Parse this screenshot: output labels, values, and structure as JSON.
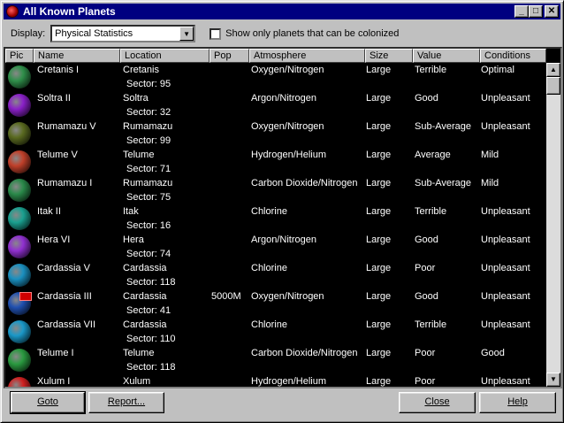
{
  "window": {
    "title": "All Known Planets"
  },
  "titlebar_buttons": {
    "minimize": "_",
    "maximize": "□",
    "close": "✕"
  },
  "toolbar": {
    "display_label": "Display:",
    "display_value": "Physical Statistics",
    "colonize_checkbox_label": "Show only planets that can be colonized",
    "colonize_checked": false
  },
  "columns": [
    "Pic",
    "Name",
    "Location",
    "Pop",
    "Atmosphere",
    "Size",
    "Value",
    "Conditions"
  ],
  "rows": [
    {
      "name": "Cretanis I",
      "location": "Cretanis",
      "sector": "Sector: 95",
      "pop": "",
      "atmosphere": "Oxygen/Nitrogen",
      "size": "Large",
      "value": "Terrible",
      "conditions": "Optimal",
      "color": "#2f8f4a",
      "flag": false
    },
    {
      "name": "Soltra II",
      "location": "Soltra",
      "sector": "Sector: 32",
      "pop": "",
      "atmosphere": "Argon/Nitrogen",
      "size": "Large",
      "value": "Good",
      "conditions": "Unpleasant",
      "color": "#8a20c8",
      "flag": false
    },
    {
      "name": "Rumamazu V",
      "location": "Rumamazu",
      "sector": "Sector: 99",
      "pop": "",
      "atmosphere": "Oxygen/Nitrogen",
      "size": "Large",
      "value": "Sub-Average",
      "conditions": "Unpleasant",
      "color": "#5a6a20",
      "flag": false
    },
    {
      "name": "Telume V",
      "location": "Telume",
      "sector": "Sector: 71",
      "pop": "",
      "atmosphere": "Hydrogen/Helium",
      "size": "Large",
      "value": "Average",
      "conditions": "Mild",
      "color": "#c0402a",
      "flag": false
    },
    {
      "name": "Rumamazu I",
      "location": "Rumamazu",
      "sector": "Sector: 75",
      "pop": "",
      "atmosphere": "Carbon Dioxide/Nitrogen",
      "size": "Large",
      "value": "Sub-Average",
      "conditions": "Mild",
      "color": "#2a8a4a",
      "flag": false
    },
    {
      "name": "Itak II",
      "location": "Itak",
      "sector": "Sector: 16",
      "pop": "",
      "atmosphere": "Chlorine",
      "size": "Large",
      "value": "Terrible",
      "conditions": "Unpleasant",
      "color": "#1aa090",
      "flag": false
    },
    {
      "name": "Hera VI",
      "location": "Hera",
      "sector": "Sector: 74",
      "pop": "",
      "atmosphere": "Argon/Nitrogen",
      "size": "Large",
      "value": "Good",
      "conditions": "Unpleasant",
      "color": "#9030d0",
      "flag": false
    },
    {
      "name": "Cardassia V",
      "location": "Cardassia",
      "sector": "Sector: 118",
      "pop": "",
      "atmosphere": "Chlorine",
      "size": "Large",
      "value": "Poor",
      "conditions": "Unpleasant",
      "color": "#1a90c0",
      "flag": false
    },
    {
      "name": "Cardassia III",
      "location": "Cardassia",
      "sector": "Sector: 41",
      "pop": "5000M",
      "atmosphere": "Oxygen/Nitrogen",
      "size": "Large",
      "value": "Good",
      "conditions": "Unpleasant",
      "color": "#2050b0",
      "flag": true
    },
    {
      "name": "Cardassia VII",
      "location": "Cardassia",
      "sector": "Sector: 110",
      "pop": "",
      "atmosphere": "Chlorine",
      "size": "Large",
      "value": "Terrible",
      "conditions": "Unpleasant",
      "color": "#1a98c8",
      "flag": false
    },
    {
      "name": "Telume I",
      "location": "Telume",
      "sector": "Sector: 118",
      "pop": "",
      "atmosphere": "Carbon Dioxide/Nitrogen",
      "size": "Large",
      "value": "Poor",
      "conditions": "Good",
      "color": "#2a9a40",
      "flag": false
    },
    {
      "name": "Xulum I",
      "location": "Xulum",
      "sector": "",
      "pop": "",
      "atmosphere": "Hydrogen/Helium",
      "size": "Large",
      "value": "Poor",
      "conditions": "Unpleasant",
      "color": "#d02020",
      "flag": false
    }
  ],
  "buttons": {
    "goto": "Goto",
    "report": "Report...",
    "close": "Close",
    "help": "Help"
  }
}
